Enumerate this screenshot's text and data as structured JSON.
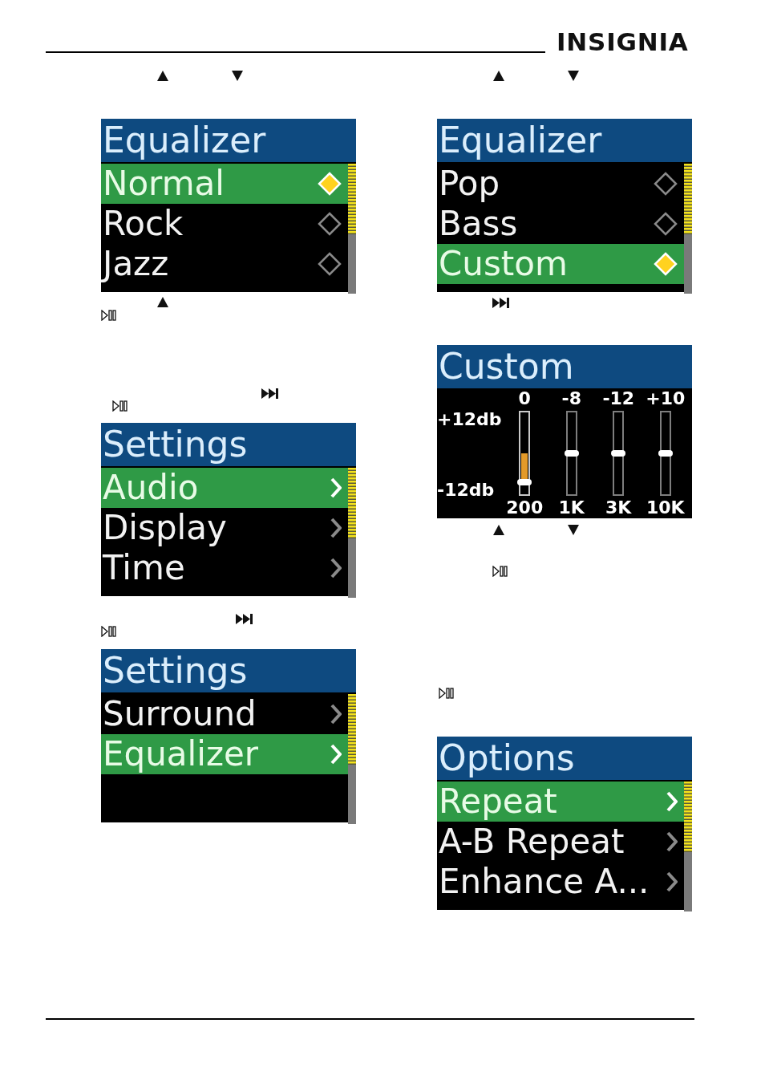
{
  "header": {
    "logo": "INSIGNIA"
  },
  "left_screens": [
    {
      "kind": "list",
      "title": "Equalizer",
      "items": [
        {
          "label": "Normal",
          "kind": "radio",
          "selected": true
        },
        {
          "label": "Rock",
          "kind": "radio",
          "selected": false
        },
        {
          "label": "Jazz",
          "kind": "radio",
          "selected": false
        }
      ]
    },
    {
      "kind": "list",
      "title": "Settings",
      "items": [
        {
          "label": "Audio",
          "kind": "submenu",
          "selected": true
        },
        {
          "label": "Display",
          "kind": "submenu",
          "selected": false
        },
        {
          "label": "Time",
          "kind": "submenu",
          "selected": false
        }
      ]
    },
    {
      "kind": "list",
      "title": "Settings",
      "items": [
        {
          "label": "Surround",
          "kind": "submenu",
          "selected": false
        },
        {
          "label": "Equalizer",
          "kind": "submenu",
          "selected": true
        }
      ]
    }
  ],
  "right_screens": [
    {
      "kind": "list",
      "title": "Equalizer",
      "items": [
        {
          "label": "Pop",
          "kind": "radio",
          "selected": false
        },
        {
          "label": "Bass",
          "kind": "radio",
          "selected": false
        },
        {
          "label": "Custom",
          "kind": "radio",
          "selected": true
        }
      ]
    },
    {
      "kind": "equalizer",
      "title": "Custom",
      "scale_top": "+12db",
      "scale_bottom": "-12db",
      "bands": [
        {
          "value": "0",
          "frequency": "200",
          "level": 0.15,
          "selected": true
        },
        {
          "value": "-8",
          "frequency": "1K",
          "level": 0.5,
          "selected": false
        },
        {
          "value": "-12",
          "frequency": "3K",
          "level": 0.5,
          "selected": false
        },
        {
          "value": "+10",
          "frequency": "10K",
          "level": 0.5,
          "selected": false
        }
      ]
    },
    {
      "kind": "list",
      "title": "Options",
      "items": [
        {
          "label": "Repeat",
          "kind": "submenu",
          "selected": true
        },
        {
          "label": "A-B Repeat",
          "kind": "submenu",
          "selected": false
        },
        {
          "label": "Enhance A...",
          "kind": "submenu",
          "selected": false
        }
      ]
    }
  ]
}
